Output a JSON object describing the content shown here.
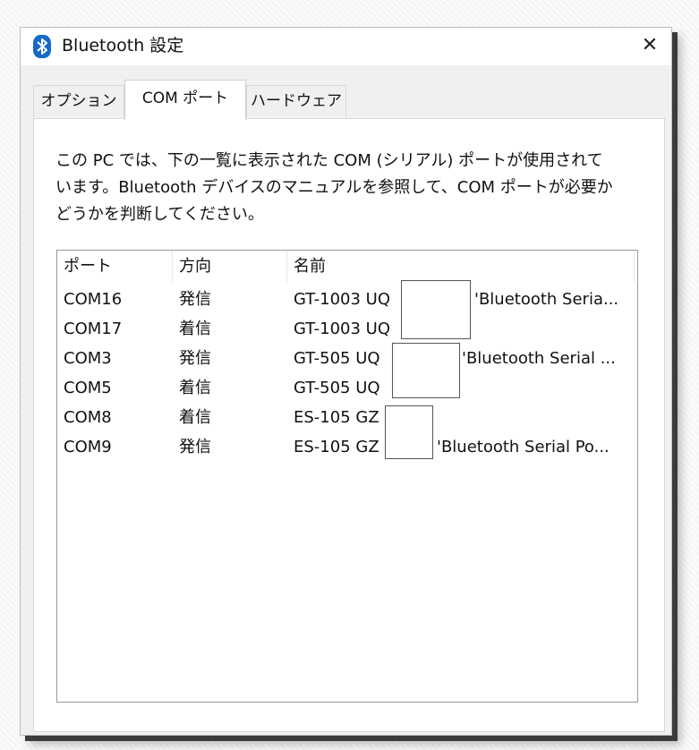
{
  "window": {
    "title": "Bluetooth 設定",
    "close_symbol": "✕",
    "icon": "bluetooth-icon"
  },
  "tabs": [
    {
      "label": "オプション",
      "active": false
    },
    {
      "label": "COM ポート",
      "active": true
    },
    {
      "label": "ハードウェア",
      "active": false
    }
  ],
  "panel": {
    "description_lines": [
      "この PC では、下の一覧に表示された COM (シリアル) ポートが使用されて",
      "います。Bluetooth デバイスのマニュアルを参照して、COM ポートが必要か",
      "どうかを判断してください。"
    ]
  },
  "table": {
    "columns": [
      "ポート",
      "方向",
      "名前"
    ],
    "rows": [
      {
        "port": "COM16",
        "direction": "発信",
        "name_prefix": "GT-1003 UQ",
        "name_suffix": "'Bluetooth Seria..."
      },
      {
        "port": "COM17",
        "direction": "着信",
        "name_prefix": "GT-1003 UQ",
        "name_suffix": ""
      },
      {
        "port": "COM3",
        "direction": "発信",
        "name_prefix": "GT-505 UQ",
        "name_suffix": "'Bluetooth Serial ..."
      },
      {
        "port": "COM5",
        "direction": "着信",
        "name_prefix": "GT-505 UQ",
        "name_suffix": ""
      },
      {
        "port": "COM8",
        "direction": "着信",
        "name_prefix": "ES-105 GZ",
        "name_suffix": ""
      },
      {
        "port": "COM9",
        "direction": "発信",
        "name_prefix": "ES-105 GZ",
        "name_suffix": "'Bluetooth Serial Po..."
      }
    ]
  },
  "colors": {
    "bluetooth_blue": "#1769c9",
    "dialog_bg": "#f0f0f0",
    "panel_bg": "#ffffff"
  }
}
